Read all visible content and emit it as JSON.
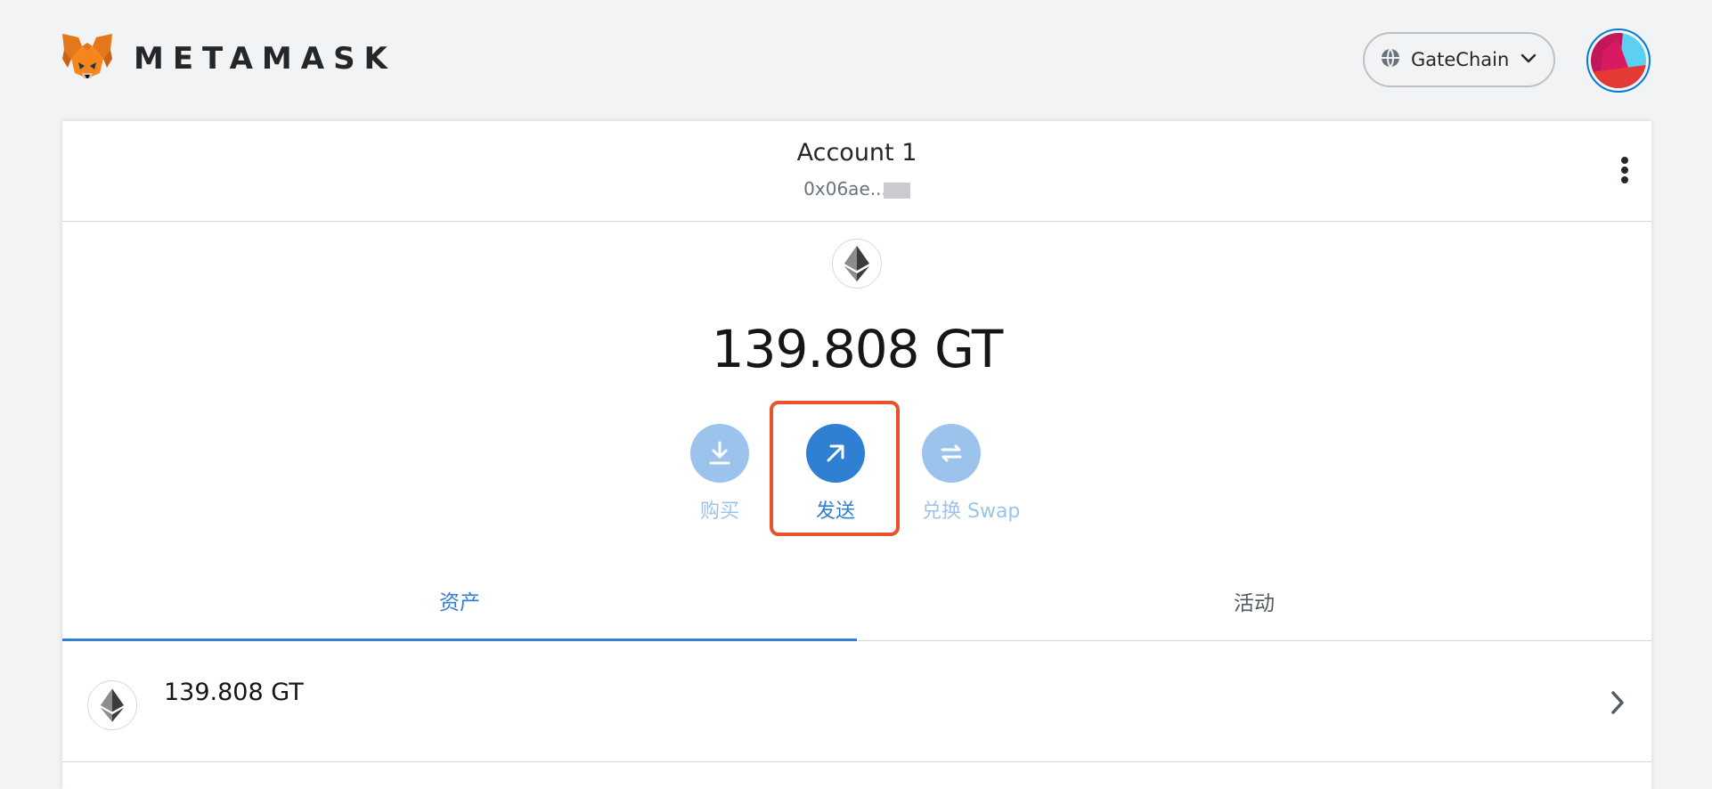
{
  "app": {
    "brand": "METAMASK",
    "logo_icon": "fox-icon"
  },
  "network": {
    "icon": "network-globe-icon",
    "label": "GateChain",
    "chevron_icon": "chevron-down-icon"
  },
  "account": {
    "name": "Account 1",
    "address": "0x06ae...",
    "menu_icon": "kebab-menu-icon",
    "avatar_icon": "jazzicon-avatar"
  },
  "balance": {
    "token_icon": "eth-diamond-icon",
    "value": "139.808 GT"
  },
  "actions": {
    "buy": {
      "label": "购买",
      "icon": "download-arrow-icon"
    },
    "send": {
      "label": "发送",
      "icon": "arrow-up-right-icon"
    },
    "swap": {
      "label": "兑换 Swap",
      "icon": "swap-arrows-icon"
    }
  },
  "tabs": {
    "assets": "资产",
    "activity": "活动"
  },
  "assets": [
    {
      "balance": "139.808 GT",
      "icon": "eth-diamond-icon",
      "chevron_icon": "chevron-right-icon"
    }
  ],
  "colors": {
    "accent": "#2f7fd3",
    "accent_light": "#9cc3ec",
    "highlight": "#e8532b",
    "background": "#f2f3f4"
  }
}
